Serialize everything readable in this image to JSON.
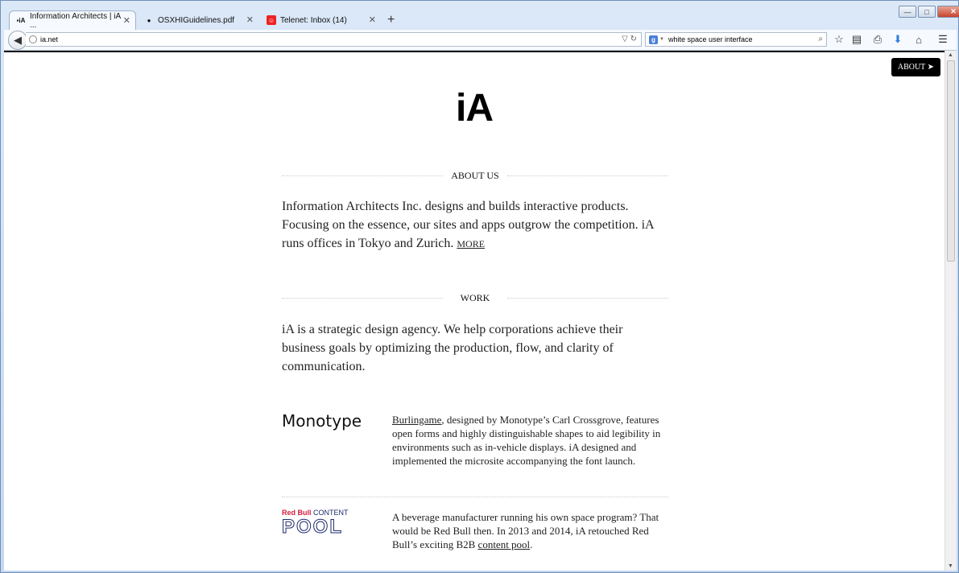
{
  "tabs": [
    {
      "label": "Information Architects | iA ...",
      "icon": "ia-favicon",
      "icon_text": "▪iA",
      "active": true
    },
    {
      "label": "OSXHIGuidelines.pdf",
      "icon": "apple-icon",
      "icon_text": "",
      "active": false
    },
    {
      "label": "Telenet: Inbox (14)",
      "icon": "telenet-icon",
      "icon_text": "☺",
      "active": false
    }
  ],
  "newtab_label": "+",
  "window_controls": {
    "minimize": "—",
    "maximize": "□",
    "close": "✕"
  },
  "navbar": {
    "url": "ia.net",
    "search_engine_badge": "g",
    "search_text": "white space user interface"
  },
  "page": {
    "about_button": "ABOUT ➤",
    "logo": "iA",
    "about_heading": "ABOUT US",
    "about_text": "Information Architects Inc. designs and builds interactive products. Focusing on the essence, our sites and apps outgrow the competition. iA runs offices in Tokyo and Zurich.",
    "about_more": "MORE",
    "work_heading": "WORK",
    "work_text": "iA is a strategic design agency. We help corporations achieve their business goals by optimizing the production, flow, and clarity of communication.",
    "cases": [
      {
        "logo_text": "Monotype",
        "link_text": "Burlingame",
        "text": ", designed by Monotype’s Carl Crossgrove, features open forms and highly distinguishable shapes to aid legibility in environments such as in-vehicle displays. iA designed and implemented the microsite accompanying the font launch."
      },
      {
        "logo_line1_a": "Red Bull",
        "logo_line1_b": "CONTENT",
        "logo_line2": "POOL",
        "text_before": "A beverage manufacturer running his own space program? That would be Red Bull then. In 2013 and 2014, iA retouched Red Bull’s exciting B2B ",
        "link_text": "content pool",
        "text_after": "."
      }
    ]
  },
  "colors": {
    "accent_black": "#000000",
    "redbull_red": "#d61e3c",
    "redbull_blue": "#1c2a6b"
  }
}
